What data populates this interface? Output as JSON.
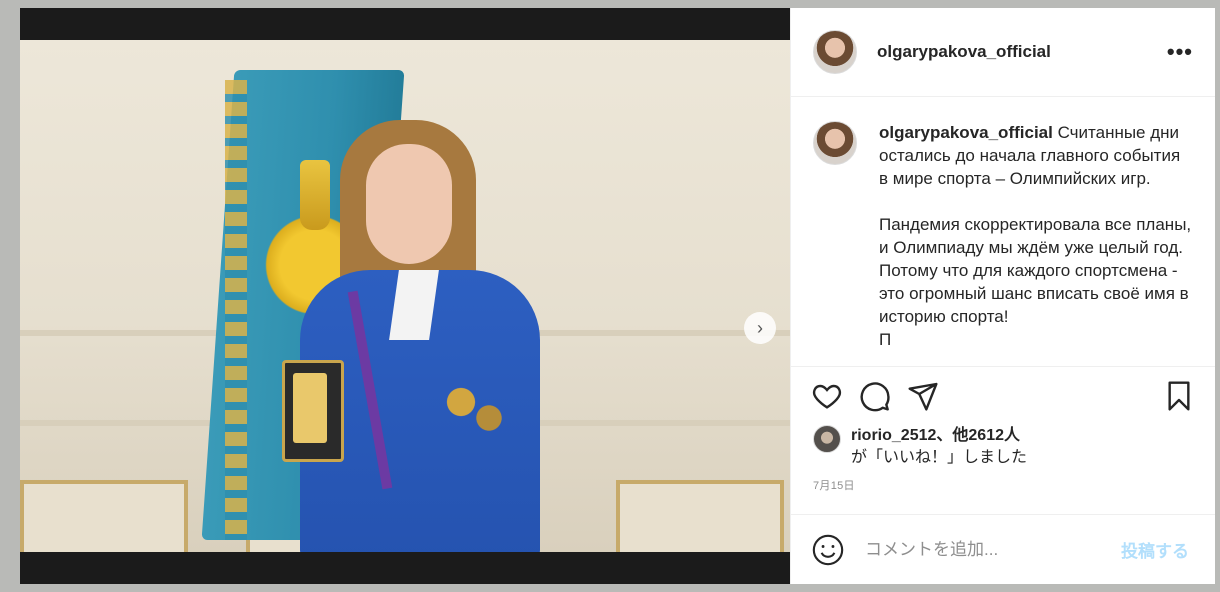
{
  "post": {
    "username": "olgarypakova_official",
    "caption": {
      "username": "olgarypakova_official",
      "text": "Считанные дни остались до начала главного события в мире спорта – Олимпийских игр.\n\nПандемия скорректировала все планы, и Олимпиаду мы ждём уже целый год. Потому что для каждого спортсмена - это огромный шанс вписать своё имя в историю спорта!\nП"
    },
    "likes": {
      "user": "riorio_2512",
      "others": "、他2612人",
      "suffix": "が「いいね！」しました"
    },
    "date": "7月15日",
    "comment_placeholder": "コメントを追加...",
    "post_button": "投稿する",
    "carousel": {
      "count": 2,
      "active_index": 0
    }
  },
  "icons": {
    "more": "more-options-icon",
    "next": "chevron-right-icon",
    "like": "heart-icon",
    "comment": "comment-bubble-icon",
    "share": "paper-plane-icon",
    "save": "bookmark-icon",
    "emoji": "emoji-smile-icon"
  },
  "colors": {
    "link_blue": "#3897f0",
    "post_button_disabled": "#b2dffc",
    "text": "#262626",
    "muted": "#8e8e8e"
  }
}
